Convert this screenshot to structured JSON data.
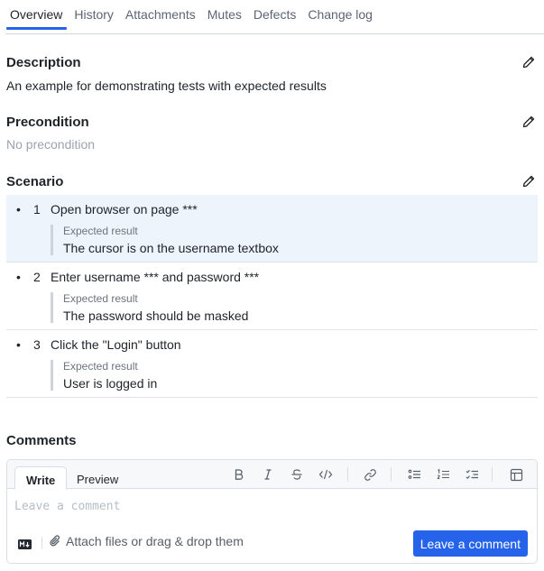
{
  "tabs": [
    {
      "label": "Overview",
      "active": true
    },
    {
      "label": "History"
    },
    {
      "label": "Attachments"
    },
    {
      "label": "Mutes"
    },
    {
      "label": "Defects"
    },
    {
      "label": "Change log"
    }
  ],
  "description": {
    "title": "Description",
    "text": "An example for demonstrating tests with expected results",
    "edit_icon": "pencil-icon"
  },
  "precondition": {
    "title": "Precondition",
    "text": "No precondition",
    "edit_icon": "pencil-icon"
  },
  "scenario": {
    "title": "Scenario",
    "edit_icon": "pencil-icon",
    "steps": [
      {
        "bullet": "•",
        "number": "1",
        "text": "Open browser on page ***",
        "expected_label": "Expected result",
        "expected": "The cursor is on the username textbox",
        "highlighted": true
      },
      {
        "bullet": "•",
        "number": "2",
        "text": "Enter username *** and password ***",
        "expected_label": "Expected result",
        "expected": "The password should be masked"
      },
      {
        "bullet": "•",
        "number": "3",
        "text": "Click the \"Login\" button",
        "expected_label": "Expected result",
        "expected": "User is logged in"
      }
    ]
  },
  "comments": {
    "title": "Comments",
    "write_tab": "Write",
    "preview_tab": "Preview",
    "toolbar": [
      "bold-icon",
      "italic-icon",
      "strikethrough-icon",
      "code-icon",
      "link-icon",
      "bulleted-list-icon",
      "numbered-list-icon",
      "task-list-icon",
      "table-icon"
    ],
    "input_value": "",
    "placeholder": "Leave a comment",
    "markdown_icon": "markdown-icon",
    "attach_label": "Attach files or drag & drop them",
    "submit_label": "Leave a comment",
    "accent_color": "#2563eb"
  }
}
